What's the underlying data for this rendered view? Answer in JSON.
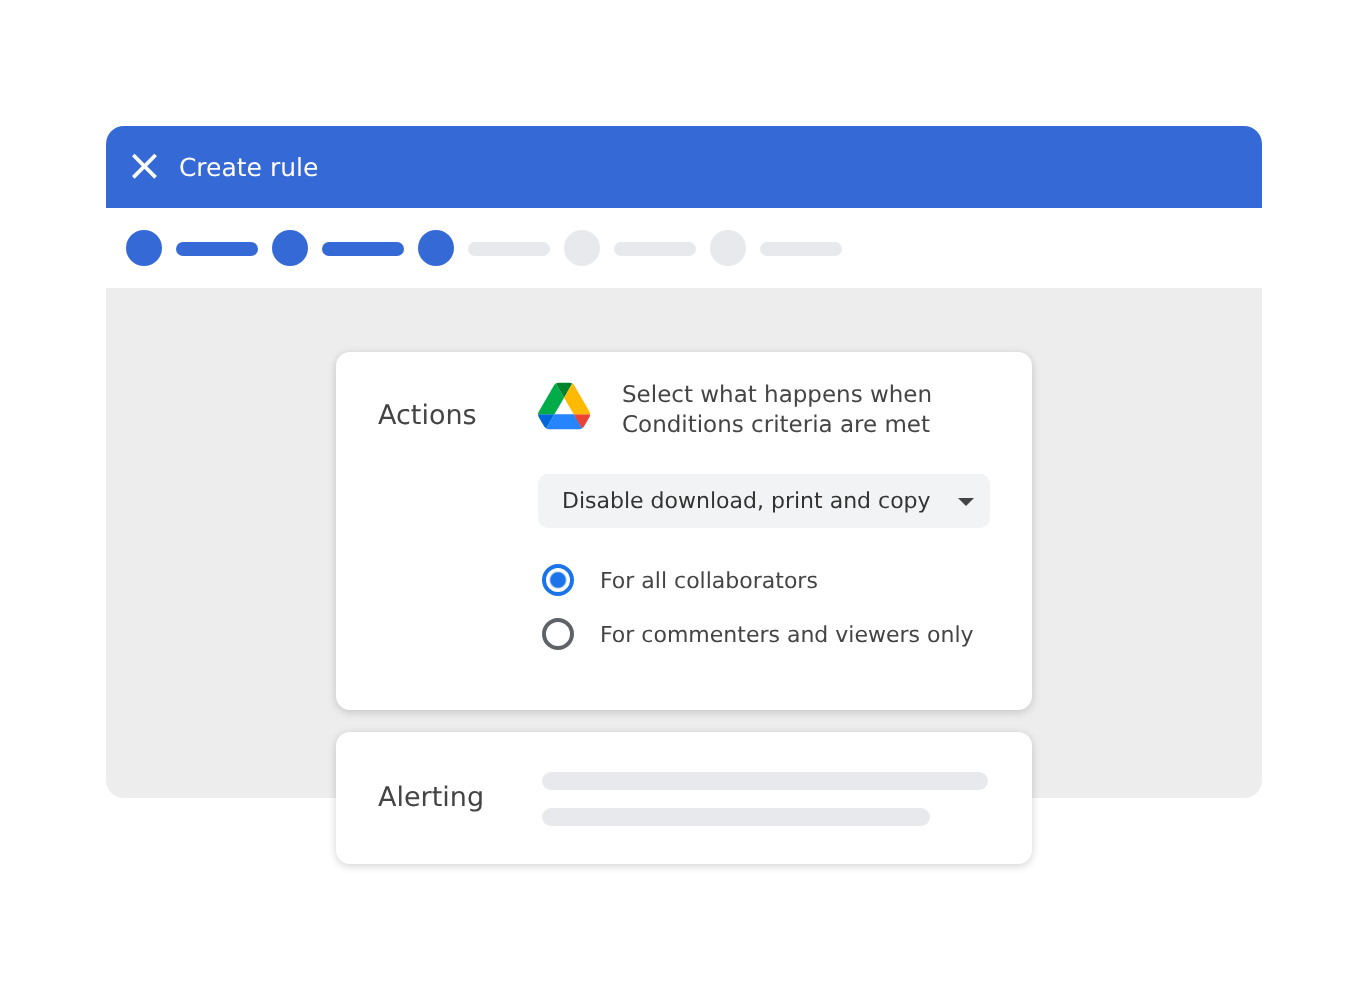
{
  "window": {
    "title": "Create rule",
    "close_icon": "×"
  },
  "stepper": {
    "steps": [
      {
        "dot_done": true,
        "line_done": true
      },
      {
        "dot_done": true,
        "line_done": true
      },
      {
        "dot_done": true,
        "line_done": false
      },
      {
        "dot_done": false,
        "line_done": false
      },
      {
        "dot_done": false,
        "line_done": false
      }
    ]
  },
  "actions_card": {
    "heading": "Actions",
    "description": "Select what happens when Conditions criteria are met",
    "dropdown": {
      "value": "Disable download, print and copy"
    },
    "options": [
      {
        "label": "For all collaborators",
        "selected": true
      },
      {
        "label": "For commenters and viewers only",
        "selected": false
      }
    ]
  },
  "alerting_card": {
    "heading": "Alerting"
  }
}
